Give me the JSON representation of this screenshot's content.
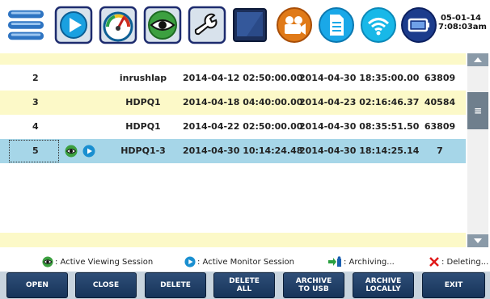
{
  "toolbar": {
    "icons": [
      "menu-icon",
      "play-monitor-icon",
      "gauge-icon",
      "eye-view-icon",
      "wrench-icon",
      "screen-icon",
      "camera-icon",
      "document-icon",
      "wifi-icon",
      "battery-icon"
    ],
    "date": "05-01-14",
    "time": "7:08:03am"
  },
  "table": {
    "rows": [
      {
        "id": "2",
        "name": "inrushlap",
        "start": "2014-04-12 02:50:00.00",
        "end": "2014-04-30 18:35:00.00",
        "size": "63809"
      },
      {
        "id": "3",
        "name": "HDPQ1",
        "start": "2014-04-18 04:40:00.00",
        "end": "2014-04-23 02:16:46.37",
        "size": "40584"
      },
      {
        "id": "4",
        "name": "HDPQ1",
        "start": "2014-04-22 02:50:00.00",
        "end": "2014-04-30 08:35:51.50",
        "size": "63809"
      },
      {
        "id": "5",
        "name": "HDPQ1-3",
        "start": "2014-04-30 10:14:24.48",
        "end": "2014-04-30 18:14:25.14",
        "size": "7"
      }
    ]
  },
  "legend": {
    "viewing": ": Active Viewing Session",
    "monitor": ": Active Monitor Session",
    "archiving": ": Archiving...",
    "deleting": ": Deleting..."
  },
  "buttons": {
    "open": "OPEN",
    "close": "CLOSE",
    "delete": "DELETE",
    "delete_all_1": "DELETE",
    "delete_all_2": "ALL",
    "archive_usb_1": "ARCHIVE",
    "archive_usb_2": "TO USB",
    "archive_local_1": "ARCHIVE",
    "archive_local_2": "LOCALLY",
    "exit": "EXIT"
  },
  "colors": {
    "row_yellow": "#fcf9c8",
    "row_selected": "#a6d6e8",
    "button_navy": "#1f3d66",
    "accent_blue": "#1a8fd0"
  }
}
